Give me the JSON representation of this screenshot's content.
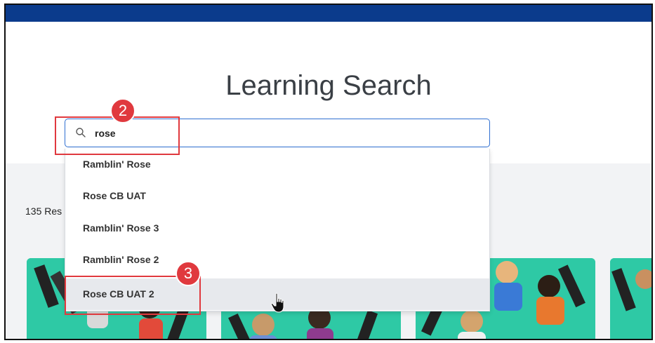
{
  "page": {
    "title": "Learning Search"
  },
  "search": {
    "value": "rose",
    "icon": "search-icon"
  },
  "suggestions": [
    {
      "label": "Ramblin' Rose"
    },
    {
      "label": "Rose CB UAT"
    },
    {
      "label": "Ramblin' Rose 3"
    },
    {
      "label": "Ramblin' Rose 2"
    },
    {
      "label": "Rose CB UAT 2",
      "hovered": true
    }
  ],
  "results": {
    "count_text": "135 Res"
  },
  "annotations": {
    "step_search": "2",
    "step_select": "3"
  },
  "colors": {
    "topbar": "#0b3b8c",
    "callout": "#e0393e",
    "card": "#2ec9a5",
    "focus": "#2f6fd1"
  }
}
